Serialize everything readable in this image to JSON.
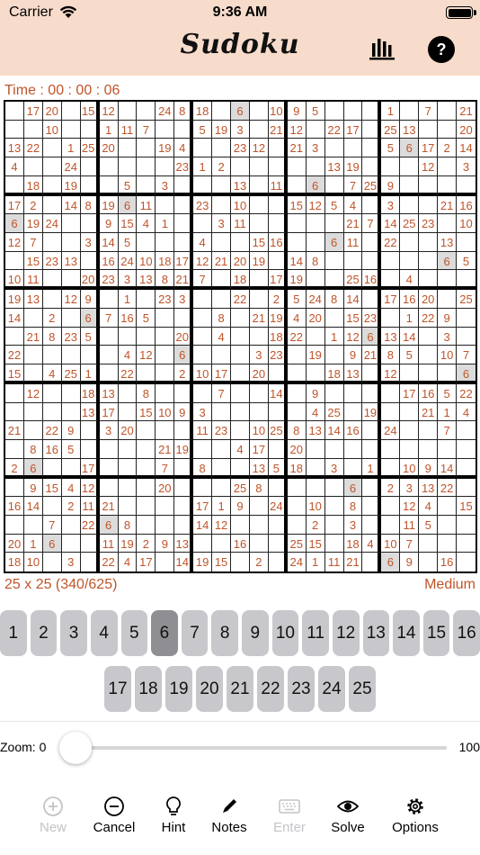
{
  "status_bar": {
    "carrier": "Carrier",
    "time": "9:36 AM"
  },
  "header": {
    "title": "Sudoku",
    "help_label": "?",
    "stats_icon": "bar-chart-icon"
  },
  "timer": {
    "text": "Time : 00 : 00 : 06"
  },
  "board": {
    "size_label": "25 x 25 (340/625)",
    "difficulty": "Medium",
    "highlight_value": "6",
    "rows": [
      [
        "",
        "17",
        "20",
        "",
        "15",
        "12",
        "",
        "",
        "24",
        "8",
        "18",
        "",
        "6",
        "",
        "10",
        "9",
        "5",
        "",
        "",
        "",
        "1",
        "",
        "7",
        "",
        "21"
      ],
      [
        "",
        "",
        "10",
        "",
        "",
        "1",
        "11",
        "7",
        "",
        "",
        "5",
        "19",
        "3",
        "",
        "21",
        "12",
        "",
        "22",
        "17",
        "",
        "25",
        "13",
        "",
        "",
        "20"
      ],
      [
        "13",
        "22",
        "",
        "1",
        "25",
        "20",
        "",
        "",
        "19",
        "4",
        "",
        "",
        "23",
        "12",
        "",
        "21",
        "3",
        "",
        "",
        "",
        "5",
        "6",
        "17",
        "2",
        "14"
      ],
      [
        "4",
        "",
        "",
        "24",
        "",
        "",
        "",
        "",
        "",
        "23",
        "1",
        "2",
        "",
        "",
        "",
        "",
        "",
        "13",
        "19",
        "",
        "",
        "",
        "12",
        "",
        "3"
      ],
      [
        "",
        "18",
        "",
        "19",
        "",
        "",
        "5",
        "",
        "3",
        "",
        "",
        "",
        "13",
        "",
        "11",
        "",
        "6",
        "",
        "7",
        "25",
        "9",
        "",
        "",
        "",
        ""
      ],
      [
        "17",
        "2",
        "",
        "14",
        "8",
        "19",
        "6",
        "11",
        "",
        "",
        "23",
        "",
        "10",
        "",
        "",
        "15",
        "12",
        "5",
        "4",
        "",
        "3",
        "",
        "",
        "21",
        "16"
      ],
      [
        "6",
        "19",
        "24",
        "",
        "",
        "9",
        "15",
        "4",
        "1",
        "",
        "",
        "3",
        "11",
        "",
        "",
        "",
        "",
        "",
        "21",
        "7",
        "14",
        "25",
        "23",
        "",
        "10"
      ],
      [
        "12",
        "7",
        "",
        "",
        "3",
        "14",
        "5",
        "",
        "",
        "",
        "4",
        "",
        "",
        "15",
        "16",
        "",
        "",
        "6",
        "11",
        "",
        "22",
        "",
        "",
        "13",
        ""
      ],
      [
        "",
        "15",
        "23",
        "13",
        "",
        "16",
        "24",
        "10",
        "18",
        "17",
        "12",
        "21",
        "20",
        "19",
        "",
        "14",
        "8",
        "",
        "",
        "",
        "",
        "",
        "",
        "6",
        "5"
      ],
      [
        "10",
        "11",
        "",
        "",
        "20",
        "23",
        "3",
        "13",
        "8",
        "21",
        "7",
        "",
        "18",
        "",
        "17",
        "19",
        "",
        "",
        "25",
        "16",
        "",
        "4",
        "",
        "",
        ""
      ],
      [
        "19",
        "13",
        "",
        "12",
        "9",
        "",
        "1",
        "",
        "23",
        "3",
        "",
        "",
        "22",
        "",
        "2",
        "5",
        "24",
        "8",
        "14",
        "",
        "17",
        "16",
        "20",
        "",
        "25"
      ],
      [
        "14",
        "",
        "2",
        "",
        "6",
        "7",
        "16",
        "5",
        "",
        "",
        "",
        "8",
        "",
        "21",
        "19",
        "4",
        "20",
        "",
        "15",
        "23",
        "",
        "1",
        "22",
        "9",
        ""
      ],
      [
        "",
        "21",
        "8",
        "23",
        "5",
        "",
        "",
        "",
        "",
        "20",
        "",
        "4",
        "",
        "",
        "18",
        "22",
        "",
        "1",
        "12",
        "6",
        "13",
        "14",
        "",
        "3",
        ""
      ],
      [
        "22",
        "",
        "",
        "",
        "",
        "",
        "4",
        "12",
        "",
        "6",
        "",
        "",
        "",
        "3",
        "23",
        "",
        "19",
        "",
        "9",
        "21",
        "8",
        "5",
        "",
        "10",
        "7"
      ],
      [
        "15",
        "",
        "4",
        "25",
        "1",
        "",
        "22",
        "",
        "",
        "2",
        "10",
        "17",
        "",
        "20",
        "",
        "",
        "",
        "18",
        "13",
        "",
        "12",
        "",
        "",
        "",
        "6"
      ],
      [
        "",
        "12",
        "",
        "",
        "18",
        "13",
        "",
        "8",
        "",
        "",
        "",
        "7",
        "",
        "",
        "14",
        "",
        "9",
        "",
        "",
        "",
        "",
        "17",
        "16",
        "5",
        "22"
      ],
      [
        "",
        "",
        "",
        "",
        "13",
        "17",
        "",
        "15",
        "10",
        "9",
        "3",
        "",
        "",
        "",
        "",
        "",
        "4",
        "25",
        "",
        "19",
        "",
        "",
        "21",
        "1",
        "4"
      ],
      [
        "21",
        "",
        "22",
        "9",
        "",
        "3",
        "20",
        "",
        "",
        "",
        "11",
        "23",
        "",
        "10",
        "25",
        "8",
        "13",
        "14",
        "16",
        "",
        "24",
        "",
        "",
        "7",
        ""
      ],
      [
        "",
        "8",
        "16",
        "5",
        "",
        "",
        "",
        "",
        "21",
        "19",
        "",
        "",
        "4",
        "17",
        "",
        "20",
        "",
        "",
        "",
        "",
        "",
        "",
        "",
        "",
        ""
      ],
      [
        "2",
        "6",
        "",
        "",
        "17",
        "",
        "",
        "",
        "7",
        "",
        "8",
        "",
        "",
        "13",
        "5",
        "18",
        "",
        "3",
        "",
        "1",
        "",
        "10",
        "9",
        "14",
        ""
      ],
      [
        "",
        "9",
        "15",
        "4",
        "12",
        "",
        "",
        "",
        "20",
        "",
        "",
        "",
        "25",
        "8",
        "",
        "",
        "",
        "",
        "6",
        "",
        "2",
        "3",
        "13",
        "22",
        ""
      ],
      [
        "16",
        "14",
        "",
        "2",
        "11",
        "21",
        "",
        "",
        "",
        "",
        "17",
        "1",
        "9",
        "",
        "24",
        "",
        "10",
        "",
        "8",
        "",
        "",
        "12",
        "4",
        "",
        "15"
      ],
      [
        "",
        "",
        "7",
        "",
        "22",
        "6",
        "8",
        "",
        "",
        "",
        "14",
        "12",
        "",
        "",
        "",
        "",
        "2",
        "",
        "3",
        "",
        "",
        "11",
        "5",
        "",
        ""
      ],
      [
        "20",
        "1",
        "6",
        "",
        "",
        "11",
        "19",
        "2",
        "9",
        "13",
        "",
        "",
        "16",
        "",
        "",
        "25",
        "15",
        "",
        "18",
        "4",
        "10",
        "7",
        "",
        "",
        ""
      ],
      [
        "18",
        "10",
        "",
        "3",
        "",
        "22",
        "4",
        "17",
        "",
        "14",
        "19",
        "15",
        "",
        "2",
        "",
        "24",
        "1",
        "11",
        "21",
        "",
        "6",
        "9",
        "",
        "16",
        ""
      ]
    ]
  },
  "number_pad": {
    "selected": "6",
    "row1": [
      "1",
      "2",
      "3",
      "4",
      "5",
      "6",
      "7",
      "8",
      "9",
      "10",
      "11",
      "12",
      "13",
      "14",
      "15",
      "16"
    ],
    "row2": [
      "17",
      "18",
      "19",
      "20",
      "21",
      "22",
      "23",
      "24",
      "25"
    ]
  },
  "zoom": {
    "label": "Zoom: 0",
    "max": "100",
    "value": 0
  },
  "toolbar": {
    "new": "New",
    "cancel": "Cancel",
    "hint": "Hint",
    "notes": "Notes",
    "enter": "Enter",
    "solve": "Solve",
    "options": "Options"
  }
}
